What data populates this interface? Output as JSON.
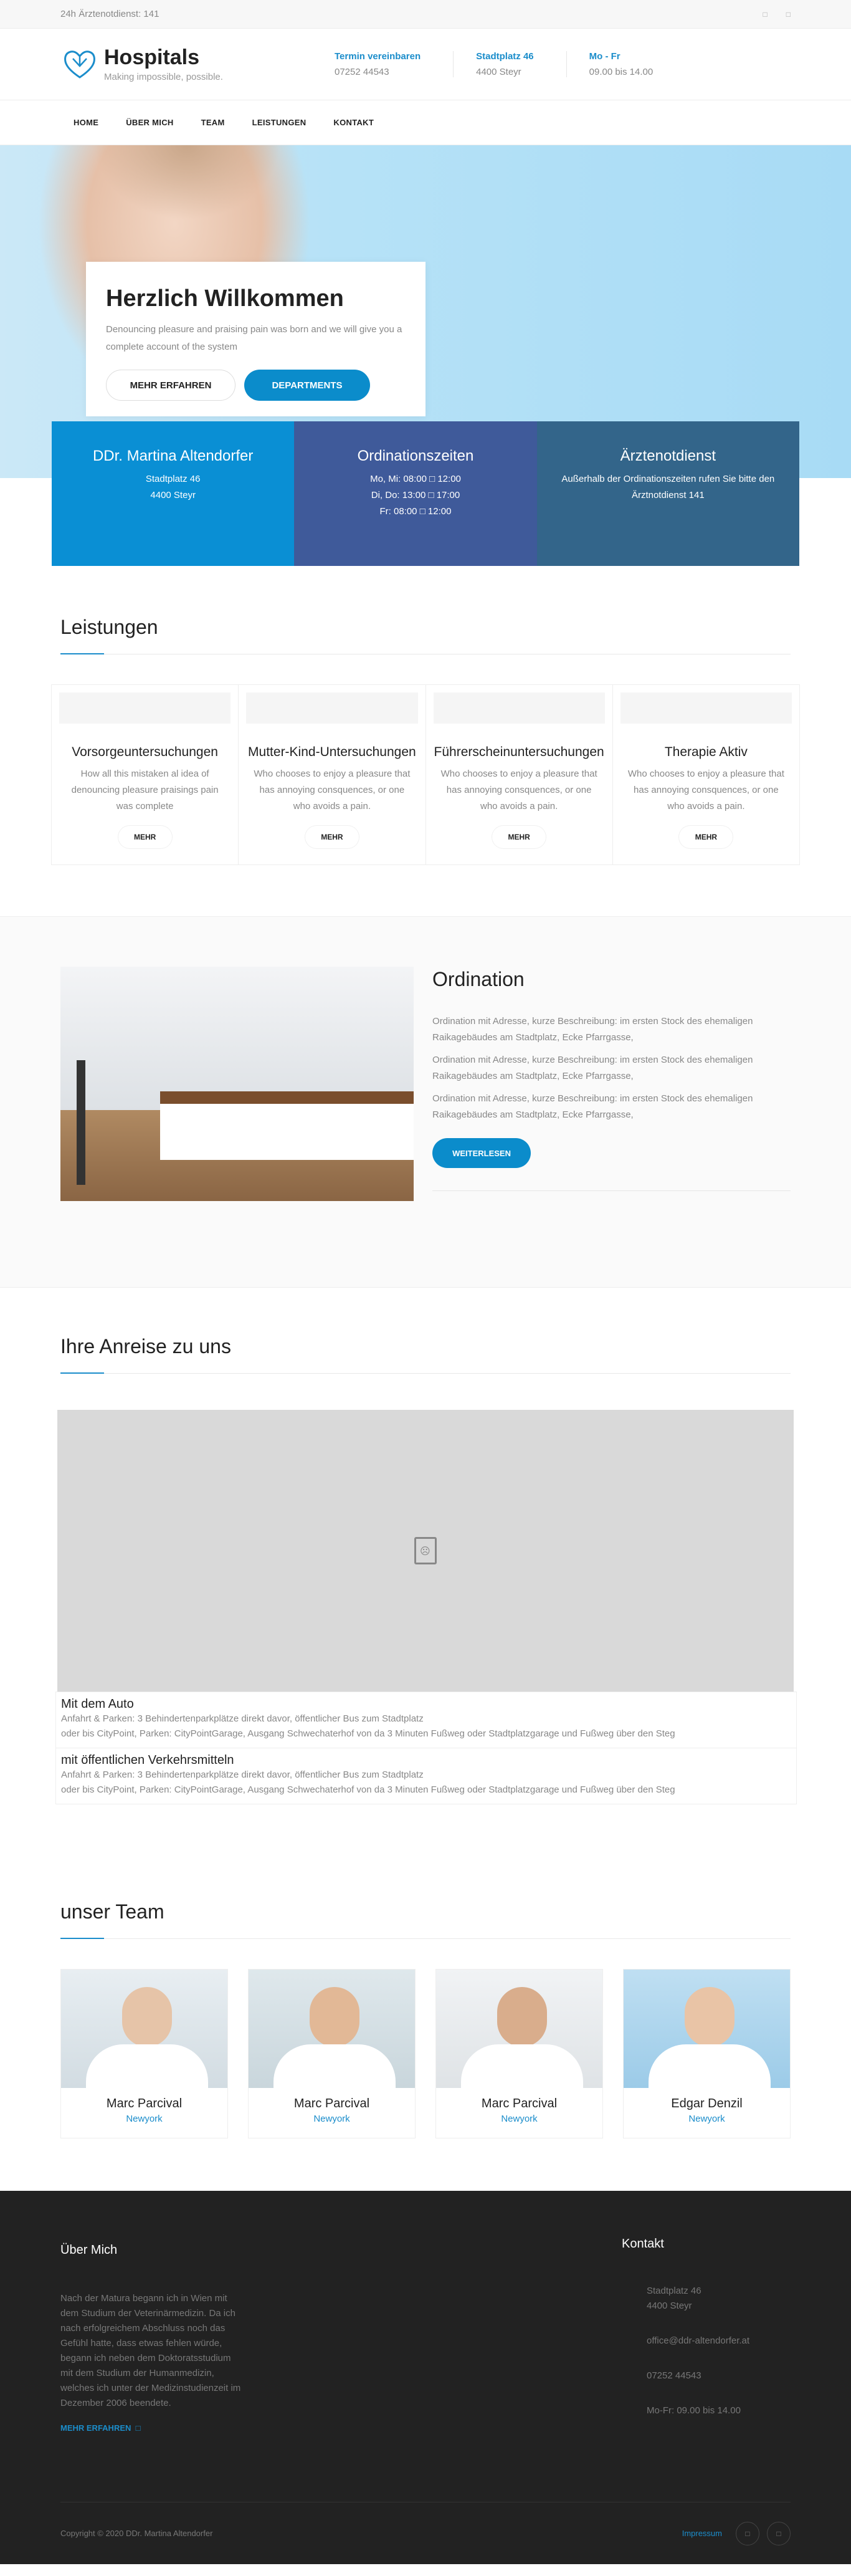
{
  "topbar": {
    "notdienst": "24h Ärztenotdienst: 141",
    "icon1": "",
    "icon2": ""
  },
  "logo": {
    "title": "Hospitals",
    "tagline": "Making impossible, possible."
  },
  "header_info": [
    {
      "label": "Termin vereinbaren",
      "value": "07252 44543"
    },
    {
      "label": "Stadtplatz 46",
      "value": "4400 Steyr"
    },
    {
      "label": "Mo - Fr",
      "value": "09.00 bis 14.00"
    }
  ],
  "nav": [
    "HOME",
    "ÜBER MICH",
    "TEAM",
    "LEISTUNGEN",
    "KONTAKT"
  ],
  "hero": {
    "title": "Herzlich Willkommen",
    "text": "Denouncing pleasure and praising pain was born and we will give you a complete account of the system",
    "btn1": "MEHR ERFAHREN",
    "btn2": "DEPARTMENTS"
  },
  "infoboxes": [
    {
      "title": "DDr. Martina Altendorfer",
      "lines": [
        "Stadtplatz 46",
        "4400 Steyr"
      ]
    },
    {
      "title": "Ordinationszeiten",
      "lines": [
        "Mo, Mi: 08:00 □ 12:00",
        "Di, Do: 13:00 □ 17:00",
        "Fr: 08:00 □ 12:00"
      ]
    },
    {
      "title": "Ärztenotdienst",
      "lines": [
        "Außerhalb der Ordinationszeiten rufen Sie bitte den Ärztnotdienst 141"
      ]
    }
  ],
  "leistungen": {
    "title": "Leistungen",
    "items": [
      {
        "name": "Vorsorgeuntersuchungen",
        "text": "How all this mistaken al idea of denouncing pleasure praisings pain was complete",
        "button": "MEHR"
      },
      {
        "name": "Mutter-Kind-Untersuchungen",
        "text": "Who chooses to enjoy a pleasure that has annoying consquences, or one who avoids a pain.",
        "button": "MEHR"
      },
      {
        "name": "Führerscheinuntersuchungen",
        "text": "Who chooses to enjoy a pleasure that has annoying consquences, or one who avoids a pain.",
        "button": "MEHR"
      },
      {
        "name": "Therapie Aktiv",
        "text": "Who chooses to enjoy a pleasure that has annoying consquences, or one who avoids a pain.",
        "button": "MEHR"
      }
    ]
  },
  "ordination": {
    "title": "Ordination",
    "paragraphs": [
      "Ordination mit Adresse, kurze Beschreibung: im ersten Stock des ehemaligen Raikagebäudes am Stadtplatz, Ecke Pfarrgasse,",
      "Ordination mit Adresse, kurze Beschreibung: im ersten Stock des ehemaligen Raikagebäudes am Stadtplatz, Ecke Pfarrgasse,",
      "Ordination mit Adresse, kurze Beschreibung: im ersten Stock des ehemaligen Raikagebäudes am Stadtplatz, Ecke Pfarrgasse,"
    ],
    "button": "WEITERLESEN"
  },
  "anreise": {
    "title": "Ihre Anreise zu uns",
    "routes": [
      {
        "title": "Mit dem Auto",
        "lines": [
          "Anfahrt & Parken: 3 Behindertenparkplätze direkt davor, öffentlicher Bus zum Stadtplatz",
          "oder bis CityPoint, Parken: CityPointGarage, Ausgang Schwechaterhof von da 3 Minuten Fußweg oder Stadtplatzgarage und Fußweg über den Steg"
        ]
      },
      {
        "title": "mit öffentlichen Verkehrsmitteln",
        "lines": [
          "Anfahrt & Parken: 3 Behindertenparkplätze direkt davor, öffentlicher Bus zum Stadtplatz",
          "oder bis CityPoint, Parken: CityPointGarage, Ausgang Schwechaterhof von da 3 Minuten Fußweg oder Stadtplatzgarage und Fußweg über den Steg"
        ]
      }
    ]
  },
  "team": {
    "title": "unser Team",
    "members": [
      {
        "name": "Marc Parcival",
        "city": "Newyork"
      },
      {
        "name": "Marc Parcival",
        "city": "Newyork"
      },
      {
        "name": "Marc Parcival",
        "city": "Newyork"
      },
      {
        "name": "Edgar Denzil",
        "city": "Newyork"
      }
    ]
  },
  "footer": {
    "about_title": "Über Mich",
    "about_text": "Nach der Matura begann ich in Wien mit dem Studium der Veterinärmedizin. Da ich nach erfolgreichem Abschluss noch das Gefühl hatte, dass etwas fehlen würde, begann ich neben dem Doktoratsstudium mit dem Studium der Humanmedizin, welches ich unter der Medizinstudienzeit im Dezember 2006 beendete.",
    "about_more": "MEHR ERFAHREN",
    "kontakt_title": "Kontakt",
    "kontakt": {
      "address1": "Stadtplatz 46",
      "address2": "4400 Steyr",
      "email": "office@ddr-altendorfer.at",
      "phone": "07252 44543",
      "hours": "Mo-Fr: 09.00 bis 14.00"
    },
    "copyright": "Copyright © 2020 DDr. Martina Altendorfer",
    "impressum": "Impressum"
  },
  "colors": {
    "accent": "#1b8dcb",
    "box1": "#0a8fd4",
    "box2": "#3f5a9a",
    "box3": "#33658a",
    "footer": "#222222"
  }
}
